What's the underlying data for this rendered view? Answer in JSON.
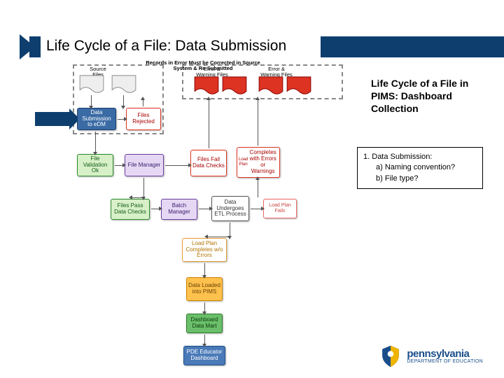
{
  "title": "Life Cycle of a File: Data Submission",
  "sidebar": {
    "heading": "Life Cycle of a File in PIMS: Dashboard Collection",
    "step_num": "1.",
    "step_label": "Data Submission:",
    "a": "a)",
    "a_txt": "Naming convention?",
    "b": "b)",
    "b_txt": "File type?"
  },
  "banners": {
    "source": "Source Files",
    "correct": "Records in Error Must be Corrected in Source System & Re-Submitted",
    "ew1": "Error & Warning Files",
    "ew2": "Error & Warning Files"
  },
  "nodes": {
    "data_sub": "Data Submission to eDM",
    "rejected": "Files Rejected",
    "val_ok": "File Validation Ok",
    "file_mgr": "File Manager",
    "fail_checks": "Files Fail Data Checks",
    "comp_ew": "Completes with Errors or Warnings",
    "load_plan": "Load Plan",
    "pass_checks": "Files Pass Data Checks",
    "batch_mgr": "Batch Manager",
    "etl": "Data Undergoes ETL Process",
    "lp_fails": "Load Plan Fails",
    "lp_ok": "Load Plan Completes w/o Errors",
    "loaded": "Data Loaded into PIMS",
    "mart": "Dashboard Data Mart",
    "dash": "PDE Educator Dashboard"
  },
  "logo": {
    "name": "pennsylvania",
    "dept": "DEPARTMENT OF EDUCATION"
  }
}
